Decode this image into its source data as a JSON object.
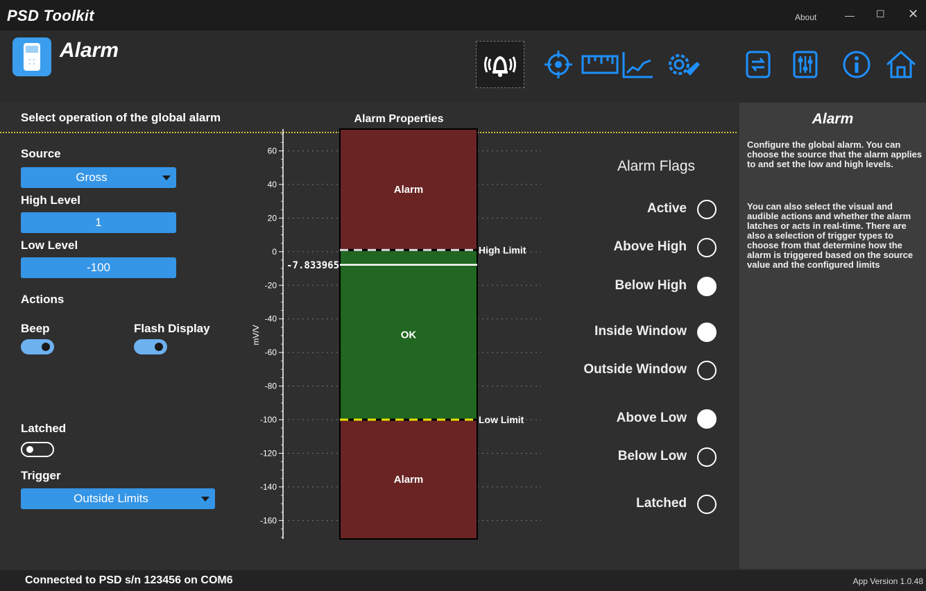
{
  "window": {
    "title": "PSD Toolkit",
    "about": "About",
    "minimize": "—",
    "maximize": "☐",
    "close": "✕"
  },
  "page": {
    "title": "Alarm"
  },
  "nav": [
    {
      "name": "alarm",
      "icon": "alarm-bell-icon",
      "active": true
    },
    {
      "name": "target",
      "icon": "target-icon"
    },
    {
      "name": "ruler",
      "icon": "ruler-icon"
    },
    {
      "name": "chart",
      "icon": "chart-line-icon"
    },
    {
      "name": "settings",
      "icon": "gear-wrench-icon"
    },
    {
      "name": "file-transfer",
      "icon": "file-transfer-icon"
    },
    {
      "name": "sliders",
      "icon": "sliders-icon"
    },
    {
      "name": "info",
      "icon": "info-icon"
    },
    {
      "name": "home",
      "icon": "home-icon"
    }
  ],
  "left": {
    "heading": "Select operation of the global alarm",
    "source_label": "Source",
    "source_value": "Gross",
    "high_label": "High Level",
    "high_value": "1",
    "low_label": "Low Level",
    "low_value": "-100",
    "actions_label": "Actions",
    "beep_label": "Beep",
    "beep_on": true,
    "flash_label": "Flash Display",
    "flash_on": true,
    "latched_label": "Latched",
    "latched_on": false,
    "trigger_label": "Trigger",
    "trigger_value": "Outside Limits"
  },
  "chart": {
    "title": "Alarm Properties",
    "ylabel": "mV/V",
    "ticks": [
      "60",
      "40",
      "20",
      "0",
      "-20",
      "-40",
      "-60",
      "-80",
      "-100",
      "-120",
      "-140",
      "-160"
    ],
    "tick_values": [
      60,
      40,
      20,
      0,
      -20,
      -40,
      -60,
      -80,
      -100,
      -120,
      -140,
      -160
    ],
    "ylim": [
      -171,
      73
    ],
    "high_limit": 1,
    "low_limit": -100,
    "current_value": -7.833965,
    "current_label": "-7.833965",
    "high_limit_label": "High Limit",
    "low_limit_label": "Low Limit",
    "upper_zone_label": "Alarm",
    "middle_zone_label": "OK",
    "lower_zone_label": "Alarm",
    "colors": {
      "alarm": "#6a2424",
      "ok": "#216621",
      "high_line": "#d8d8d8",
      "low_line": "#e8e000"
    }
  },
  "flags": {
    "title": "Alarm Flags",
    "items": [
      {
        "label": "Active",
        "on": false
      },
      {
        "label": "Above High",
        "on": false
      },
      {
        "label": "Below High",
        "on": true
      },
      {
        "label": "Inside Window",
        "on": true
      },
      {
        "label": "Outside Window",
        "on": false
      },
      {
        "label": "Above Low",
        "on": true
      },
      {
        "label": "Below Low",
        "on": false
      },
      {
        "label": "Latched",
        "on": false
      }
    ]
  },
  "help": {
    "title": "Alarm",
    "para1": "Configure the global alarm. You can choose the source that the alarm applies to and set the low and high levels.",
    "para2": "You can also select the visual and audible actions and whether the alarm latches or acts in real-time. There are also a selection of trigger types to choose from that determine how the alarm is triggered based on the source value and the configured limits"
  },
  "status": {
    "connection": "Connected to PSD s/n 123456 on COM6",
    "version": "App Version 1.0.48"
  },
  "colors": {
    "accent": "#3595e6",
    "icon_blue": "#1e90ff"
  }
}
